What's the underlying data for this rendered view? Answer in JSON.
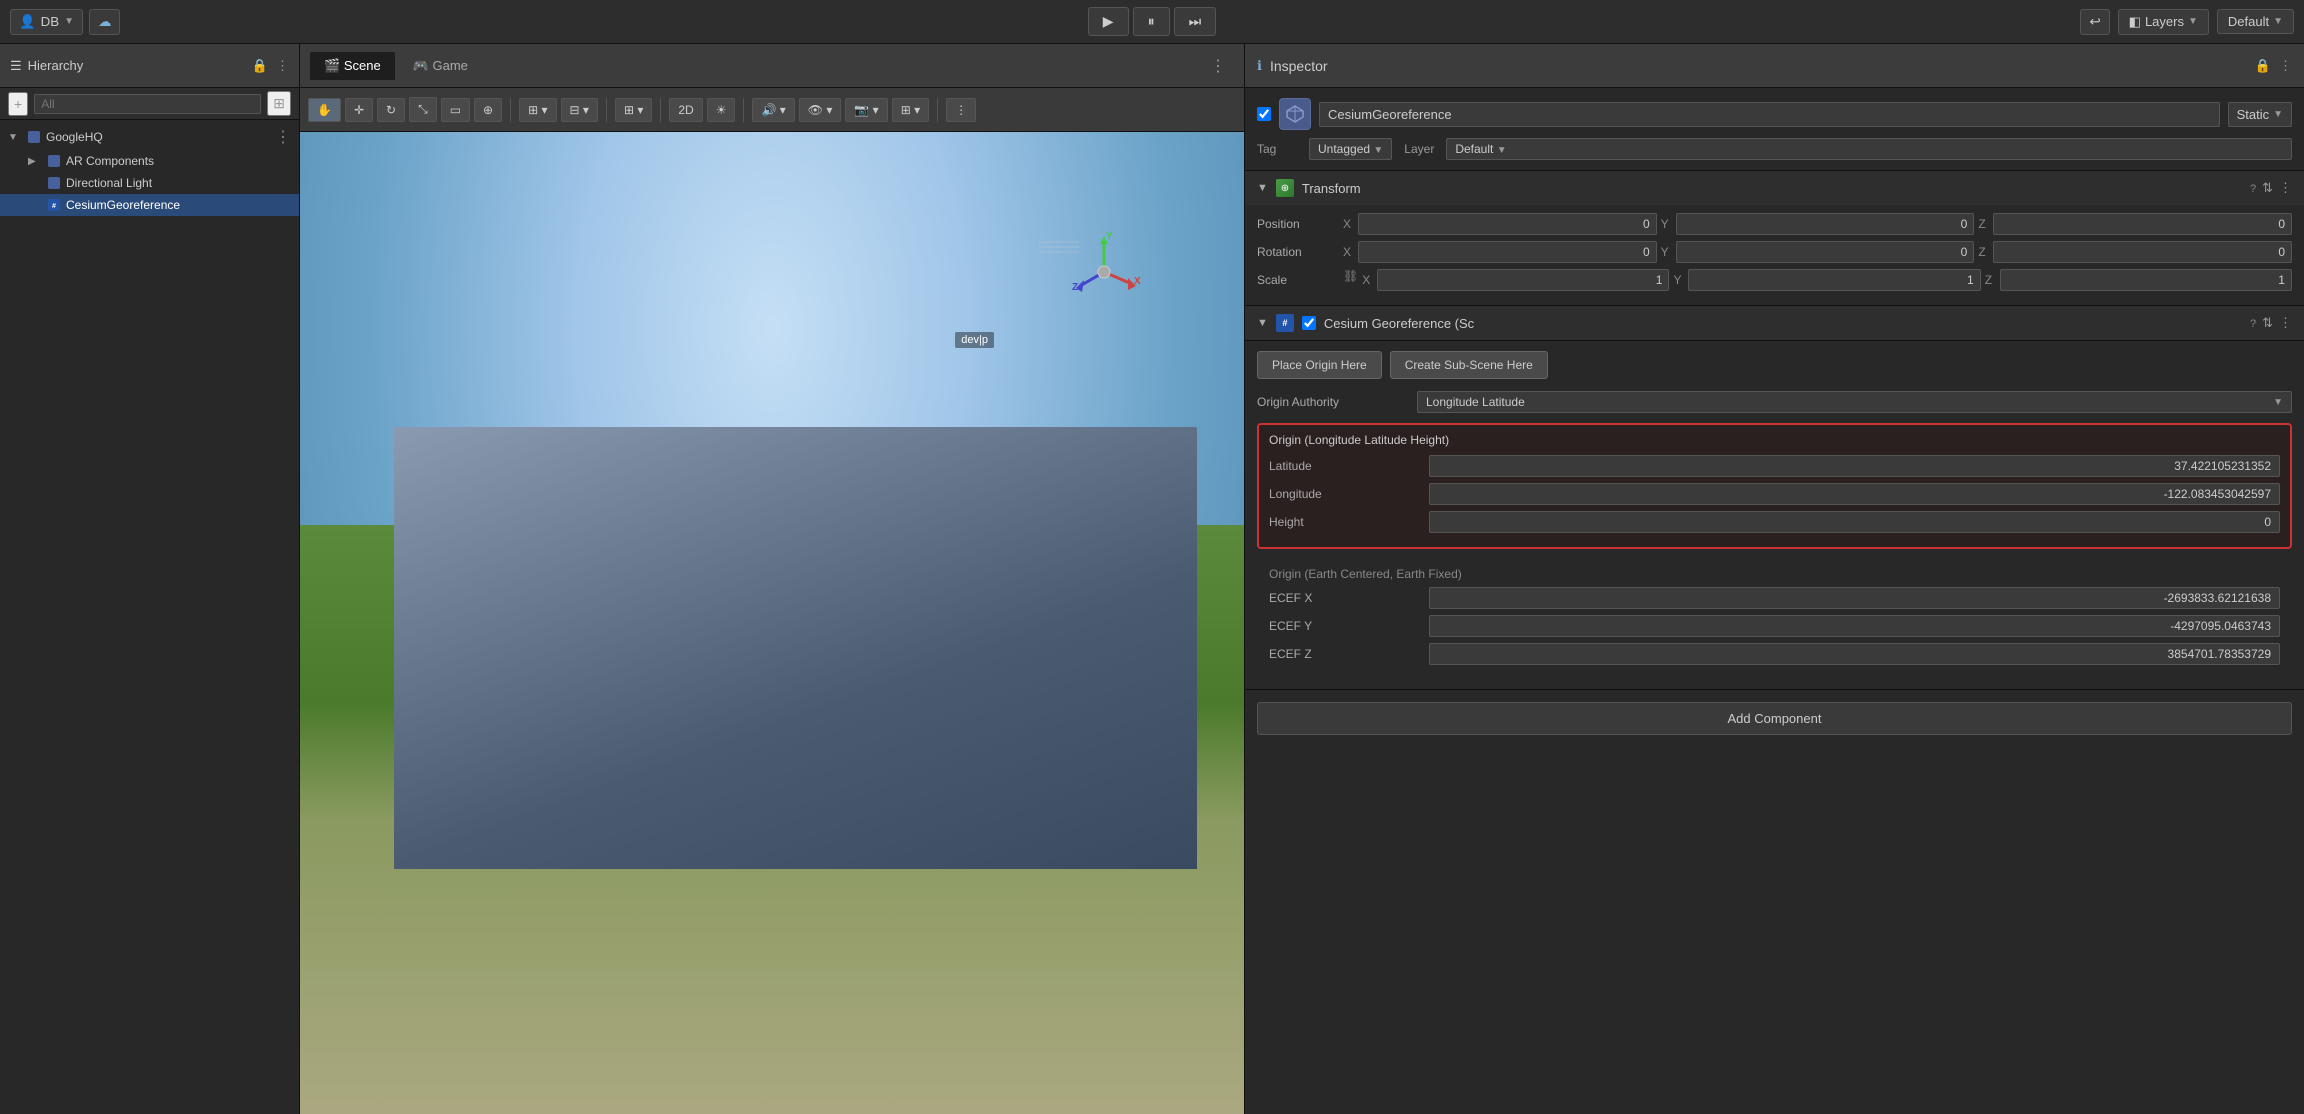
{
  "topbar": {
    "account": "DB",
    "layers_label": "Layers",
    "default_label": "Default",
    "play_btn": "▶",
    "pause_btn": "⏸",
    "step_btn": "⏭"
  },
  "hierarchy": {
    "title": "Hierarchy",
    "search_placeholder": "All",
    "items": [
      {
        "label": "GoogleHQ",
        "level": 0,
        "expanded": true,
        "type": "gameobject"
      },
      {
        "label": "AR Components",
        "level": 1,
        "expanded": false,
        "type": "gameobject"
      },
      {
        "label": "Directional Light",
        "level": 1,
        "expanded": false,
        "type": "gameobject"
      },
      {
        "label": "CesiumGeoreference",
        "level": 1,
        "selected": true,
        "type": "gameobject"
      }
    ]
  },
  "scene": {
    "tabs": [
      "Scene",
      "Game"
    ],
    "active_tab": "Scene"
  },
  "inspector": {
    "title": "Inspector",
    "object_name": "CesiumGeoreference",
    "static_label": "Static",
    "tag_label": "Tag",
    "tag_value": "Untagged",
    "layer_label": "Layer",
    "transform": {
      "title": "Transform",
      "position_label": "Position",
      "rotation_label": "Rotation",
      "scale_label": "Scale",
      "position": {
        "x": "0",
        "y": "0",
        "z": "0"
      },
      "rotation": {
        "x": "0",
        "y": "0",
        "z": "0"
      },
      "scale": {
        "x": "1",
        "y": "1",
        "z": "1"
      }
    },
    "cesium": {
      "component_title": "Cesium Georeference (Sc",
      "place_origin_btn": "Place Origin Here",
      "create_sub_scene_btn": "Create Sub-Scene Here",
      "origin_authority_label": "Origin Authority",
      "origin_authority_value": "Longitude Latitude",
      "origin_box_title": "Origin (Longitude Latitude Height)",
      "latitude_label": "Latitude",
      "latitude_value": "37.422105231352",
      "longitude_label": "Longitude",
      "longitude_value": "-122.083453042597",
      "height_label": "Height",
      "height_value": "0",
      "ecef_title": "Origin (Earth Centered, Earth Fixed)",
      "ecef_x_label": "ECEF X",
      "ecef_x_value": "-2693833.62121638",
      "ecef_y_label": "ECEF Y",
      "ecef_y_value": "-4297095.0463743",
      "ecef_z_label": "ECEF Z",
      "ecef_z_value": "3854701.78353729"
    },
    "add_component_btn": "Add Component"
  }
}
